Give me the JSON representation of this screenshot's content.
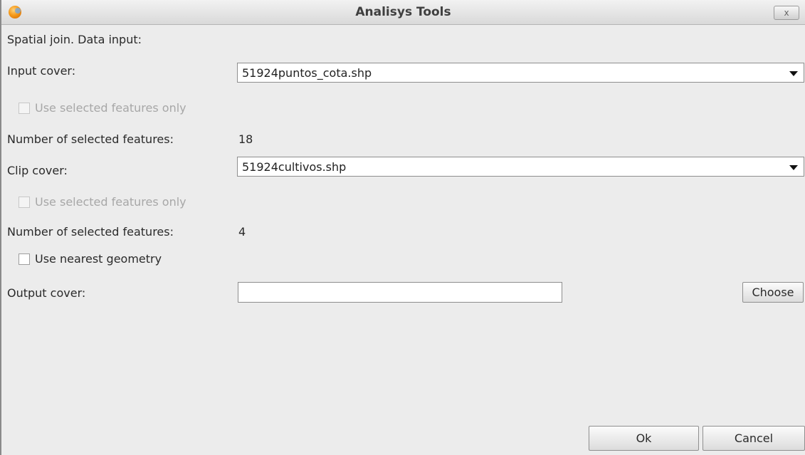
{
  "window": {
    "title": "Analisys Tools",
    "close_label": "x"
  },
  "form": {
    "heading": "Spatial join. Data input:",
    "input_cover_label": "Input cover:",
    "input_cover_value": "51924puntos_cota.shp",
    "input_use_selected_label": "Use selected features only",
    "input_selected_count_label": "Number of selected features:",
    "input_selected_count_value": "18",
    "clip_cover_label": "Clip cover:",
    "clip_cover_value": "51924cultivos.shp",
    "clip_use_selected_label": "Use selected features only",
    "clip_selected_count_label": "Number of selected features:",
    "clip_selected_count_value": "4",
    "nearest_geometry_label": "Use nearest geometry",
    "output_cover_label": "Output cover:",
    "output_cover_value": ""
  },
  "buttons": {
    "choose": "Choose",
    "ok": "Ok",
    "cancel": "Cancel"
  }
}
